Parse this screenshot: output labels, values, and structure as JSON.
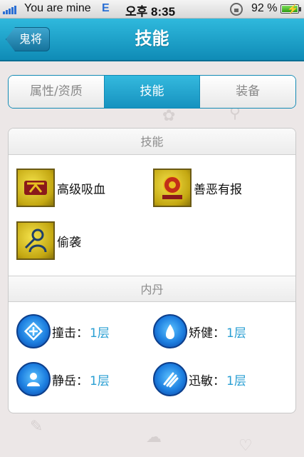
{
  "status_bar": {
    "carrier": "You are mine",
    "network": "E",
    "time": "오후 8:35",
    "battery_pct": "92 %",
    "battery_level": 0.92
  },
  "nav": {
    "back_label": "鬼将",
    "title": "技能"
  },
  "tabs": [
    {
      "label": "属性/资质",
      "active": false
    },
    {
      "label": "技能",
      "active": true
    },
    {
      "label": "装备",
      "active": false
    }
  ],
  "skills": {
    "header": "技能",
    "items": [
      {
        "icon": "blood-drain-icon",
        "label": "高级吸血"
      },
      {
        "icon": "karma-wheel-icon",
        "label": "善恶有报"
      },
      {
        "icon": "sneak-attack-icon",
        "label": "偷袭"
      }
    ]
  },
  "neidan": {
    "header": "内丹",
    "items": [
      {
        "icon": "impact-icon",
        "name": "撞击：",
        "level": "1层"
      },
      {
        "icon": "agility-icon",
        "name": "矫健：",
        "level": "1层"
      },
      {
        "icon": "calm-mountain-icon",
        "name": "静岳：",
        "level": "1层"
      },
      {
        "icon": "swift-claw-icon",
        "name": "迅敏：",
        "level": "1层"
      }
    ]
  },
  "colors": {
    "nav_bar": "#1aa2cc",
    "active_tab": "#1692bf",
    "level_text": "#2a9fd3",
    "background": "#ece7e7"
  }
}
